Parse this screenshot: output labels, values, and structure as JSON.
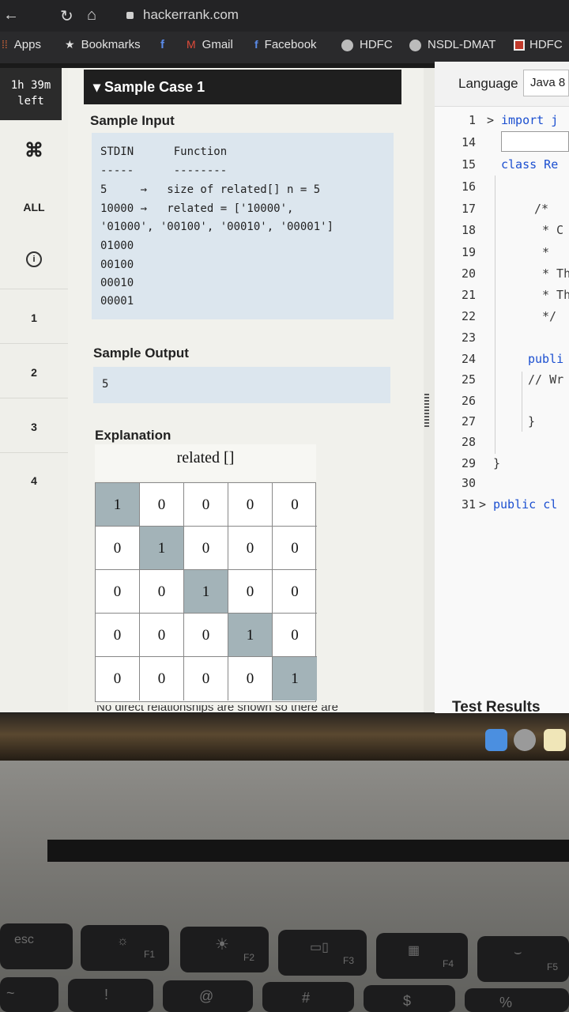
{
  "browser": {
    "url": "hackerrank.com",
    "bookmarks": [
      {
        "label": "Apps",
        "icon": "apps-grid-icon"
      },
      {
        "label": "Bookmarks",
        "icon": "star-icon"
      },
      {
        "label": "f",
        "icon": "facebook-icon"
      },
      {
        "label": "Gmail",
        "icon": "gmail-icon"
      },
      {
        "label": "Facebook",
        "icon": "facebook-icon"
      },
      {
        "label": "HDFC",
        "icon": "globe-icon"
      },
      {
        "label": "NSDL-DMAT",
        "icon": "globe-icon"
      },
      {
        "label": "HDFC",
        "icon": "hdfc-icon"
      }
    ]
  },
  "sidebar": {
    "timer_line1": "1h 39m",
    "timer_line2": "left",
    "items": [
      "ALL",
      "1",
      "2",
      "3",
      "4"
    ]
  },
  "problem": {
    "case_title": "Sample Case 1",
    "sample_input_title": "Sample Input",
    "sample_input_lines": [
      "STDIN      Function",
      "-----      --------",
      "5     →   size of related[] n = 5",
      "10000 →   related = ['10000',",
      "'01000', '00100', '00010', '00001']",
      "01000",
      "00100",
      "00010",
      "00001"
    ],
    "sample_output_title": "Sample Output",
    "sample_output": "5",
    "explanation_title": "Explanation",
    "figure_title": "related []",
    "matrix": [
      [
        "1",
        "0",
        "0",
        "0",
        "0"
      ],
      [
        "0",
        "1",
        "0",
        "0",
        "0"
      ],
      [
        "0",
        "0",
        "1",
        "0",
        "0"
      ],
      [
        "0",
        "0",
        "0",
        "1",
        "0"
      ],
      [
        "0",
        "0",
        "0",
        "0",
        "1"
      ]
    ],
    "cut_text": "No direct relationships are shown so there are"
  },
  "editor": {
    "language_label": "Language",
    "language_value": "Java 8",
    "line_numbers": [
      "1",
      "14",
      "15",
      "16",
      "17",
      "18",
      "19",
      "20",
      "21",
      "22",
      "23",
      "24",
      "25",
      "26",
      "27",
      "28",
      "29",
      "30",
      "31"
    ],
    "code": {
      "l1": "import j",
      "l15": "class Re",
      "l17": "/*",
      "l18": "* C",
      "l19": "*",
      "l20": "* Th",
      "l21": "* Th",
      "l22": "*/",
      "l24": "publi",
      "l25": "// Wr",
      "l27": "}",
      "l29": "}",
      "l31": "public cl"
    },
    "test_results": "Test Results"
  },
  "keyboard": {
    "esc": "esc",
    "f1": "F1",
    "f2": "F2",
    "f3": "F3",
    "f4": "F4",
    "f5": "F5",
    "at": "@",
    "hash": "#"
  }
}
